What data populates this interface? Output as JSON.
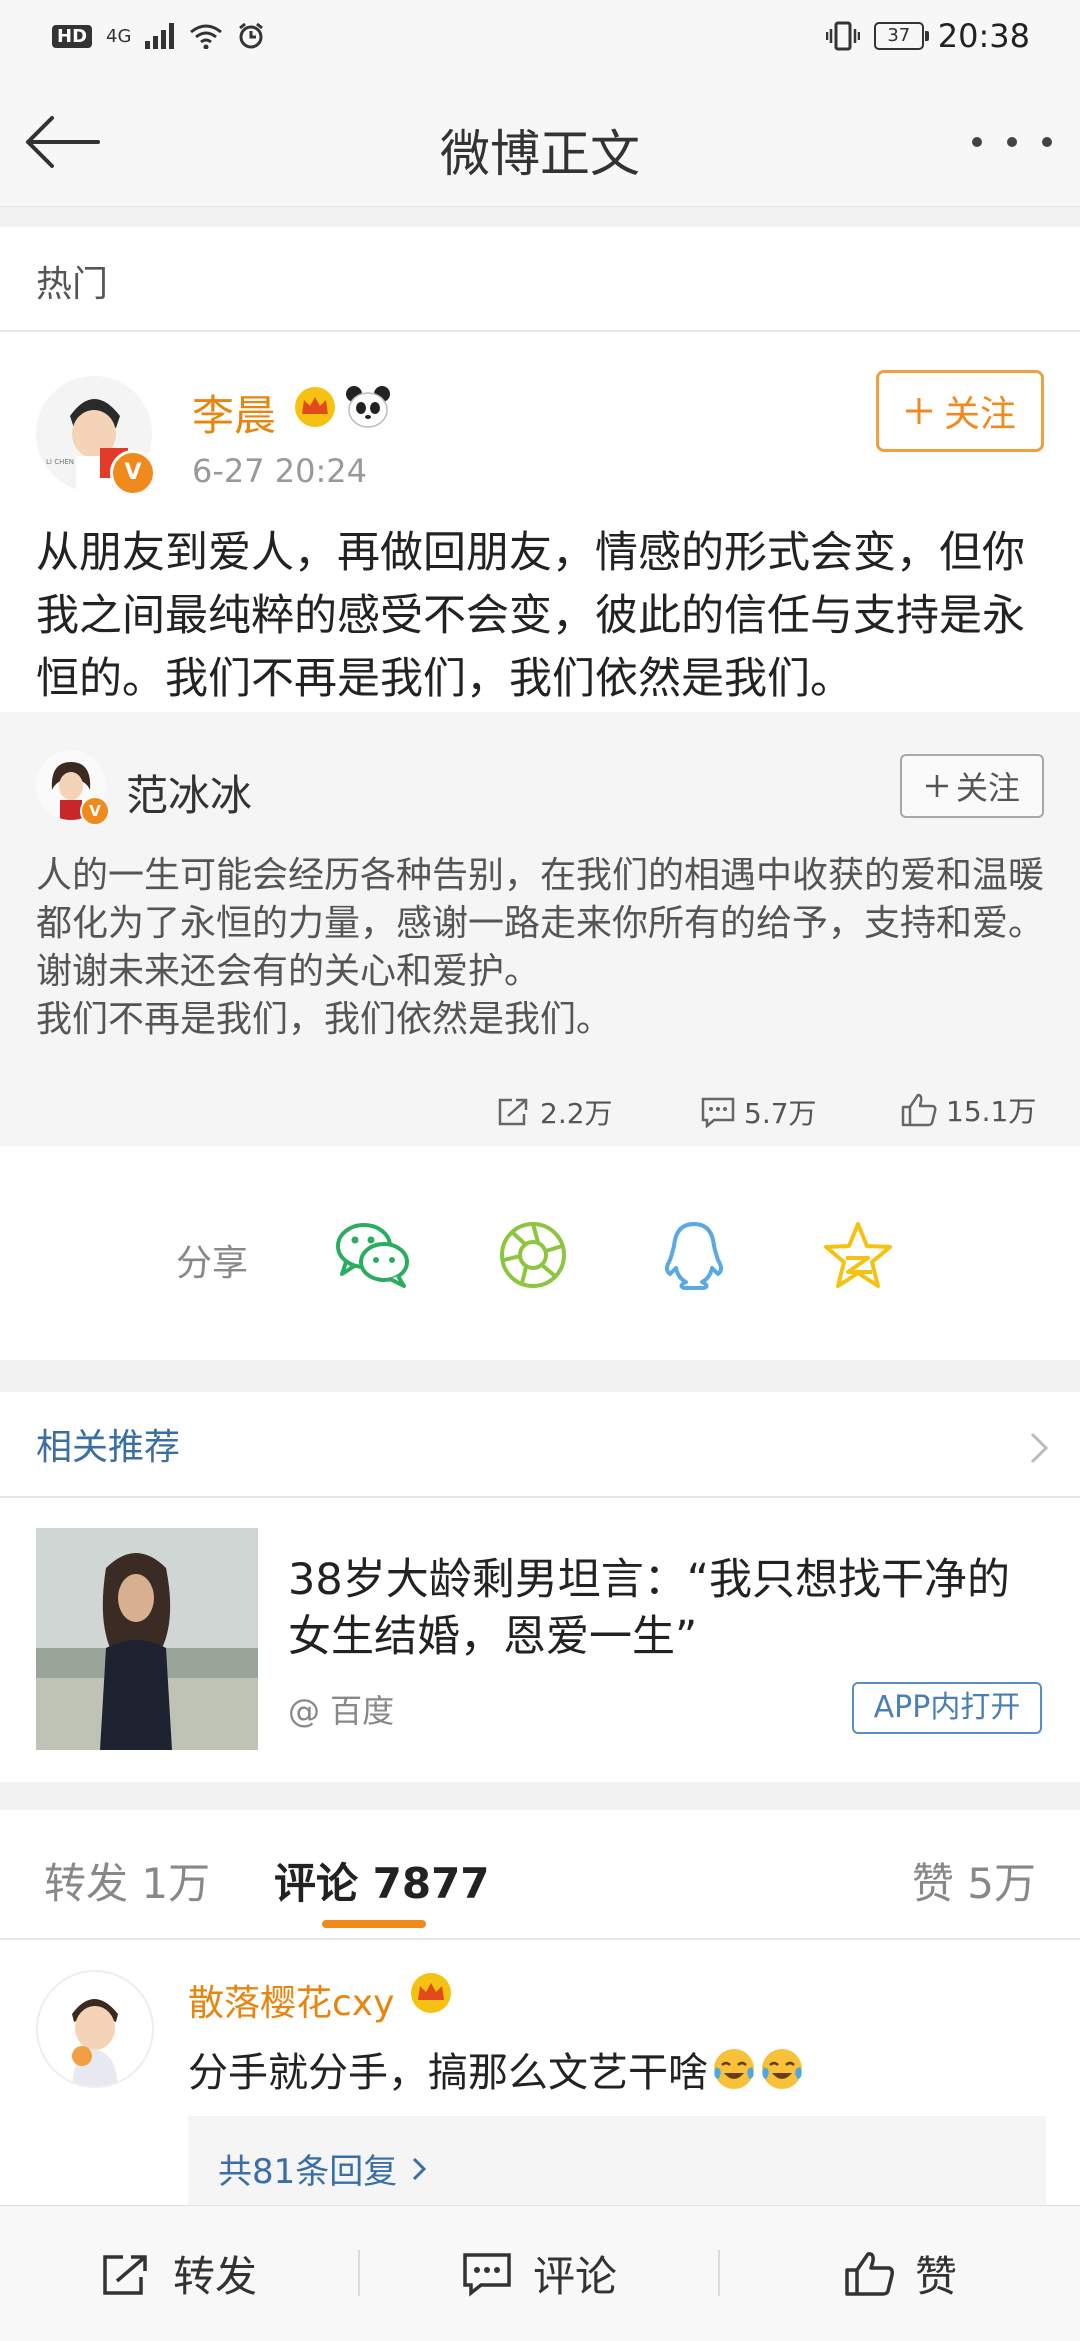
{
  "status_bar": {
    "hd": "HD",
    "network": "4G",
    "battery": "37",
    "time": "20:38"
  },
  "nav": {
    "title": "微博正文"
  },
  "section_hot": {
    "label": "热门"
  },
  "post": {
    "username": "李晨",
    "time": "6-27 20:24",
    "follow_label": "关注",
    "avatar_caption": "LI CHEN",
    "text": "从朋友到爱人，再做回朋友，情感的形式会变，但你我之间最纯粹的感受不会变，彼此的信任与支持是永恒的。我们不再是我们，我们依然是我们。"
  },
  "repost": {
    "username": "范冰冰",
    "follow_label": "关注",
    "text": "人的一生可能会经历各种告别，在我们的相遇中收获的爱和温暖都化为了永恒的力量，感谢一路走来你所有的给予，支持和爱。谢谢未来还会有的关心和爱护。\n我们不再是我们，我们依然是我们。",
    "stats": {
      "reposts": "2.2万",
      "comments": "5.7万",
      "likes": "15.1万"
    }
  },
  "share": {
    "label": "分享",
    "targets": [
      "wechat-icon",
      "moments-icon",
      "qq-icon",
      "qzone-icon"
    ]
  },
  "related": {
    "label": "相关推荐",
    "item": {
      "title": "38岁大龄剩男坦言：“我只想找干净的女生结婚，恩爱一生”",
      "source": "@ 百度",
      "button": "APP内打开"
    }
  },
  "tabs": {
    "repost": "转发 1万",
    "comment": "评论 7877",
    "like": "赞 5万"
  },
  "comment": {
    "username": "散落樱花cxy",
    "text": "分手就分手，搞那么文艺干啥",
    "replies": "共81条回复"
  },
  "bottom_bar": {
    "repost": "转发",
    "comment": "评论",
    "like": "赞"
  },
  "colors": {
    "orange": "#f08a1c",
    "link_blue": "#3a6ea5",
    "wechat": "#2bad5f",
    "moments": "#8cc63f",
    "qq": "#5aa9e6",
    "qzone": "#f5c211"
  }
}
